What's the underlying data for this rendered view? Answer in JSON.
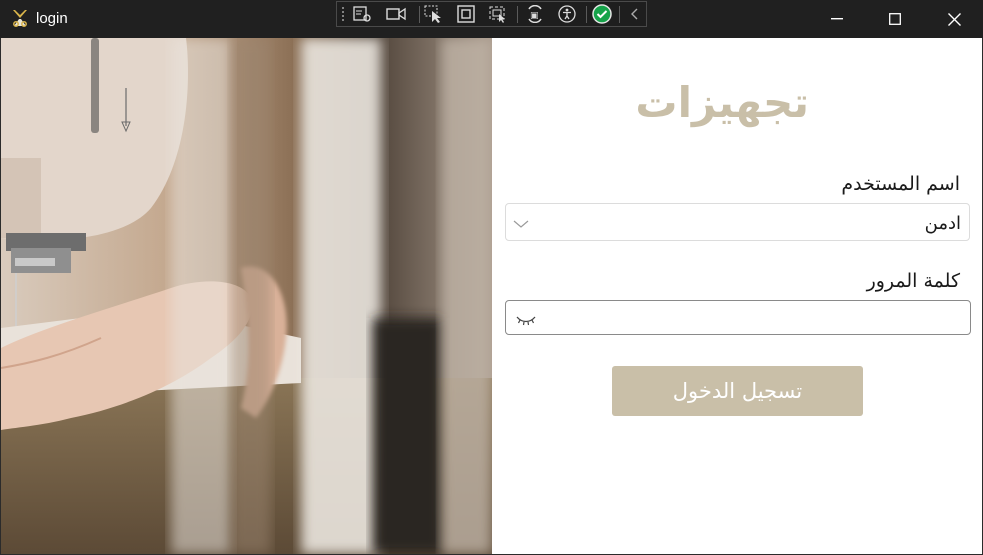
{
  "window": {
    "title": "login",
    "controls": [
      "minimize-icon",
      "maximize-icon",
      "close-icon"
    ]
  },
  "debug_toolbar": {
    "tools": [
      "grip",
      "select-element-icon",
      "record-icon",
      "pointer-select-icon",
      "display-layout-adorners-icon",
      "track-focus-icon",
      "hot-reload-icon",
      "accessibility-icon",
      "binding-failures-ok-icon",
      "collapse-chevron-icon"
    ]
  },
  "login_form": {
    "brand": "تجهيزات",
    "username_label": "اسم المستخدم",
    "username_value": "ادمن",
    "password_label": "كلمة المرور",
    "password_value": "",
    "login_button": "تسجيل الدخول"
  },
  "colors": {
    "accent": "#c9bfa8",
    "titlebar": "#202020"
  }
}
